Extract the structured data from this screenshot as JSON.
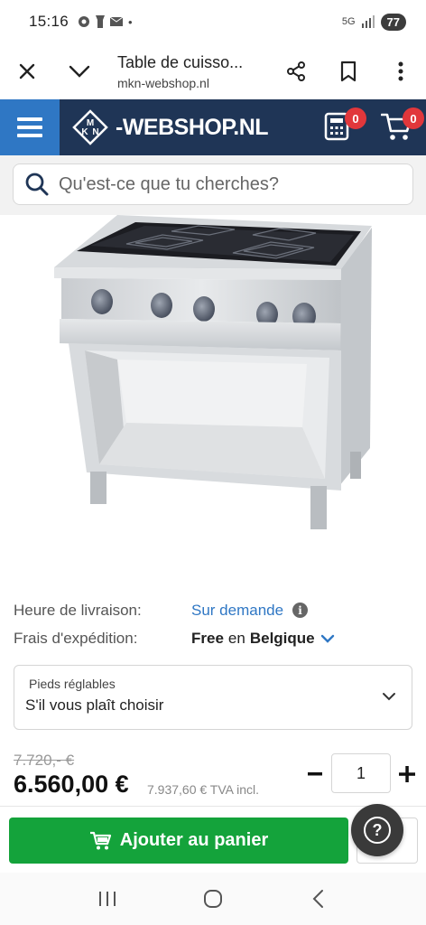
{
  "status": {
    "time": "15:16",
    "network": "5G",
    "battery": "77"
  },
  "browser": {
    "title": "Table de cuisso...",
    "url": "mkn-webshop.nl"
  },
  "site": {
    "logo_letters": "MKN",
    "logo_text": "-WEBSHOP.NL",
    "compare_count": "0",
    "cart_count": "0"
  },
  "search": {
    "placeholder": "Qu'est-ce que tu cherches?"
  },
  "product": {
    "image_alt": "Table de cuisson induction MKN sur soubassement ouvert"
  },
  "details": {
    "delivery_label": "Heure de livraison:",
    "delivery_value": "Sur demande",
    "shipping_label": "Frais d'expédition:",
    "shipping_free": "Free",
    "shipping_in": "en",
    "shipping_country": "Belgique"
  },
  "option": {
    "label": "Pieds réglables",
    "value": "S'il vous plaît choisir"
  },
  "price": {
    "old": "7.720,- €",
    "current": "6.560,00 €",
    "tva": "7.937,60 € TVA incl.",
    "quantity": "1"
  },
  "cart": {
    "add_label": "Ajouter au panier"
  },
  "colors": {
    "header_bg": "#1f3556",
    "accent_blue": "#2f77c4",
    "add_green": "#14a33b",
    "badge_red": "#e1373b"
  }
}
